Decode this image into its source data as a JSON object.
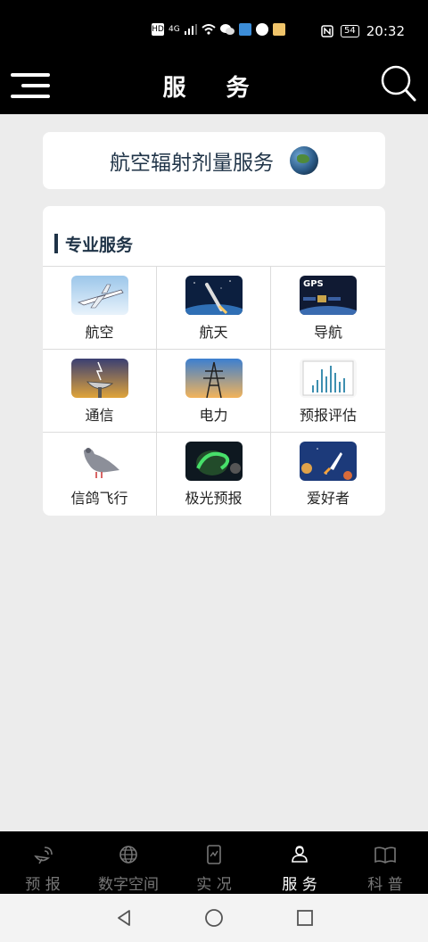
{
  "status_bar": {
    "left_icons": [
      "HD",
      "4G",
      "signal-icon",
      "wifi-icon",
      "wechat-icon",
      "mail-icon",
      "app-icon",
      "app2-icon"
    ],
    "nfc_icon": "nfc-icon",
    "battery": "54",
    "time": "20:32"
  },
  "header": {
    "title": "服 务",
    "menu_icon": "menu-icon",
    "search_icon": "search-icon"
  },
  "banner": {
    "text": "航空辐射剂量服务",
    "icon": "globe-icon"
  },
  "services": {
    "section_title": "专业服务",
    "items": [
      {
        "label": "航空",
        "icon": "airplane-image"
      },
      {
        "label": "航天",
        "icon": "rocket-launch-image"
      },
      {
        "label": "导航",
        "icon": "gps-satellite-image"
      },
      {
        "label": "通信",
        "icon": "satellite-dish-image"
      },
      {
        "label": "电力",
        "icon": "power-tower-image"
      },
      {
        "label": "预报评估",
        "icon": "bar-chart-image"
      },
      {
        "label": "信鸽飞行",
        "icon": "pigeon-image"
      },
      {
        "label": "极光预报",
        "icon": "aurora-image"
      },
      {
        "label": "爱好者",
        "icon": "space-rocket-image"
      }
    ]
  },
  "bottom_nav": {
    "items": [
      {
        "label": "预 报",
        "icon": "satellite-dish-icon",
        "active": false
      },
      {
        "label": "数字空间",
        "icon": "globe-icon",
        "active": false
      },
      {
        "label": "实 况",
        "icon": "phone-chart-icon",
        "active": false
      },
      {
        "label": "服 务",
        "icon": "service-person-icon",
        "active": true
      },
      {
        "label": "科 普",
        "icon": "book-icon",
        "active": false
      }
    ]
  },
  "system_nav": {
    "back": "back-icon",
    "home": "home-icon",
    "recents": "recents-icon"
  },
  "colors": {
    "header_bg": "#000000",
    "page_bg": "#ececec",
    "title_text": "#1f3347",
    "nav_active": "#ffffff",
    "nav_inactive": "#777777"
  }
}
